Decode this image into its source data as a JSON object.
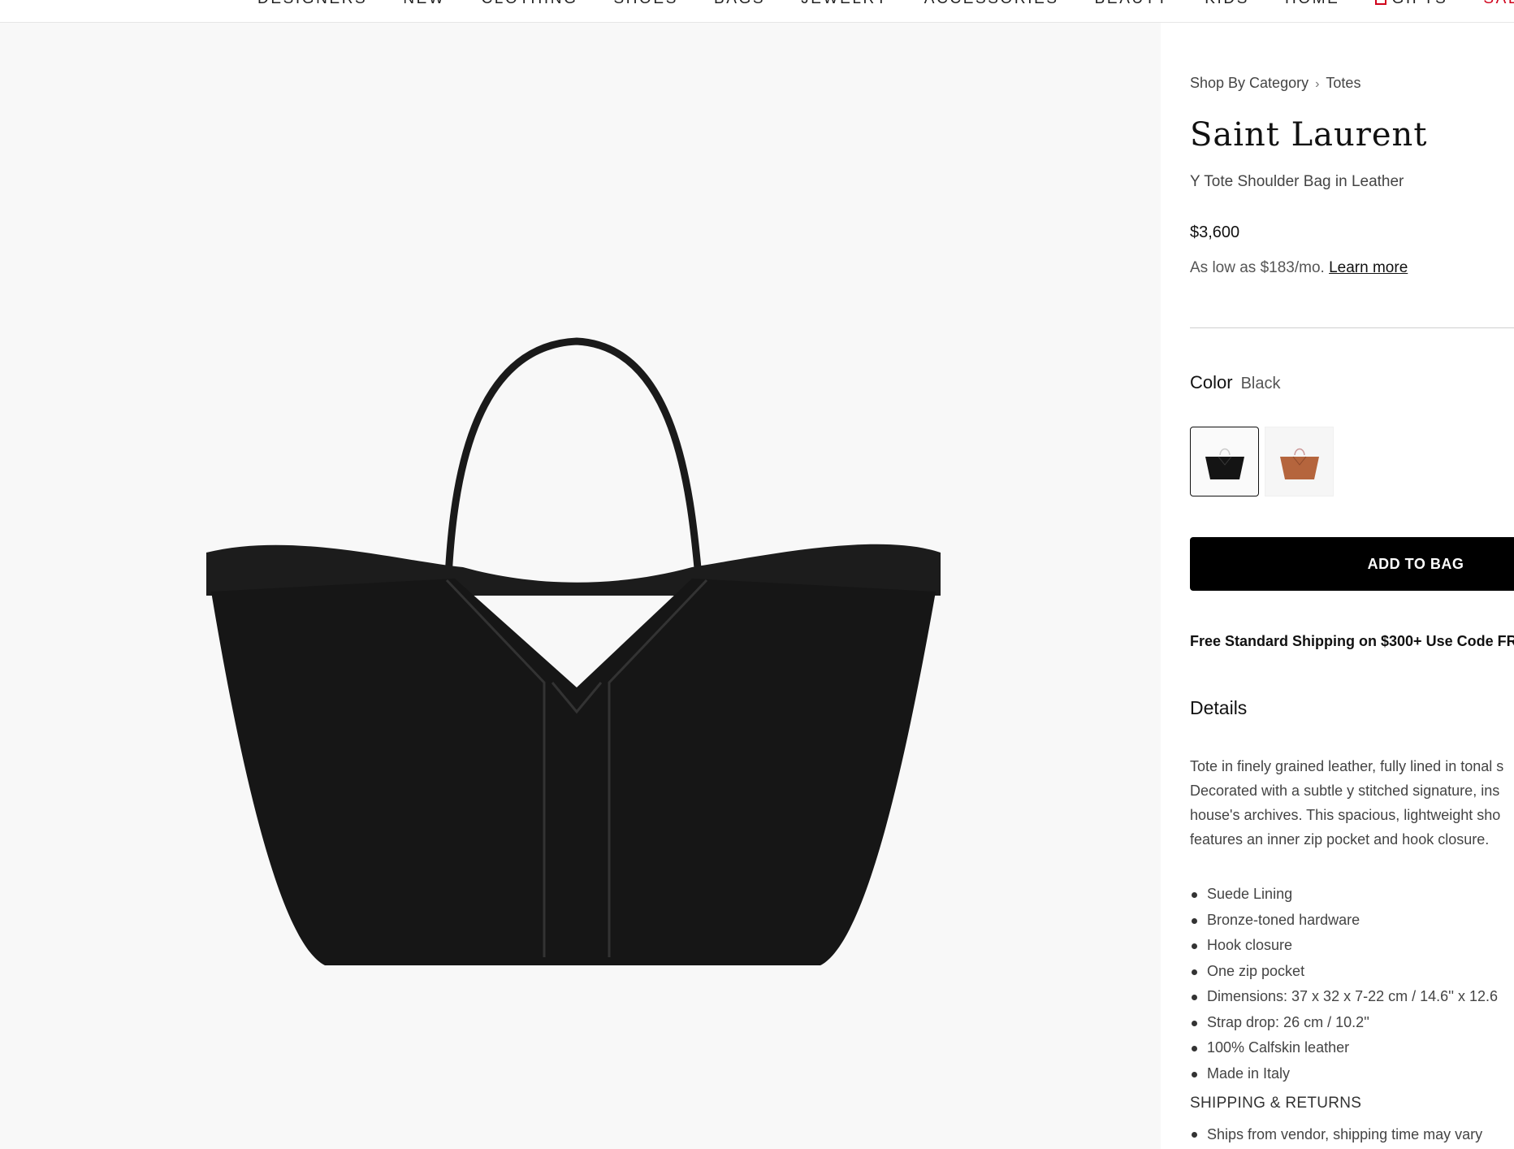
{
  "nav": {
    "items": [
      "DESIGNERS",
      "NEW",
      "CLOTHING",
      "SHOES",
      "BAGS",
      "JEWELRY",
      "ACCESSORIES",
      "BEAUTY",
      "KIDS",
      "HOME",
      "GIFTS",
      "SALE"
    ],
    "sale_color": "#d0021b"
  },
  "breadcrumb": {
    "items": [
      "Shop By Category",
      "Totes"
    ]
  },
  "product": {
    "designer": "Saint Laurent",
    "name": "Y Tote Shoulder Bag in Leather",
    "price": "$3,600",
    "installment_text": "As low as $183/mo.",
    "installment_link": "Learn more"
  },
  "color": {
    "label": "Color",
    "selected": "Black",
    "swatches": [
      {
        "name": "Black",
        "hex": "#141414"
      },
      {
        "name": "Brown",
        "hex": "#b5653d"
      }
    ]
  },
  "cta": {
    "add_to_bag": "ADD TO BAG"
  },
  "promo": {
    "shipping": "Free Standard Shipping on $300+ Use Code FR"
  },
  "details": {
    "heading": "Details",
    "description_lines": [
      "Tote in finely grained leather, fully lined in tonal s",
      "Decorated with a subtle y stitched signature, ins",
      "house's archives. This spacious, lightweight sho",
      "features an inner zip pocket and hook closure."
    ],
    "features": [
      "Suede Lining",
      "Bronze-toned hardware",
      "Hook closure",
      "One zip pocket",
      "Dimensions: 37 x 32 x 7-22 cm / 14.6'' x 12.6",
      "Strap drop: 26 cm / 10.2''",
      "100% Calfskin leather",
      "Made in Italy"
    ]
  },
  "shipping_returns": {
    "heading": "SHIPPING & RETURNS",
    "items": [
      "Ships from vendor, shipping time may vary"
    ]
  }
}
